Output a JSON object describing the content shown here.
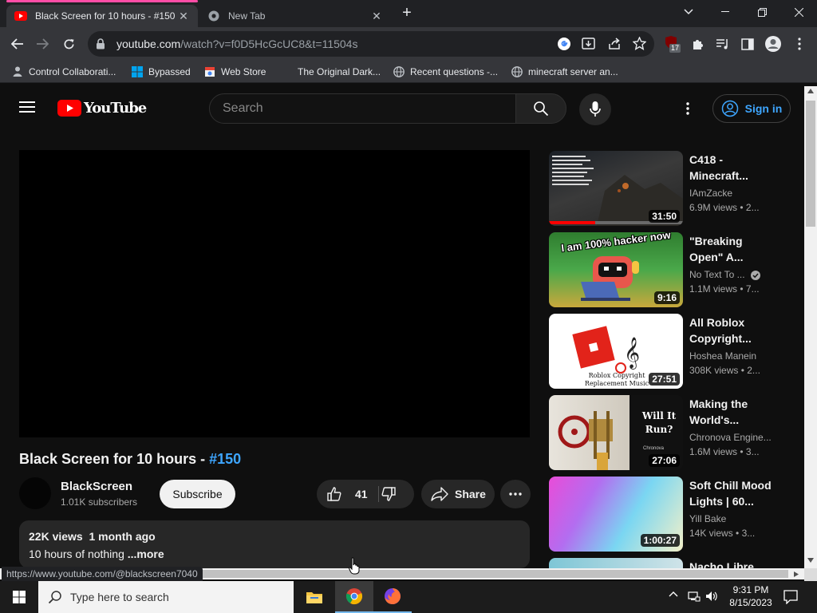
{
  "browser": {
    "tabs": [
      {
        "title": "Black Screen for 10 hours - #150",
        "active": true
      },
      {
        "title": "New Tab",
        "active": false
      }
    ],
    "url_host": "youtube.com",
    "url_path": "/watch?v=f0D5HcGcUC8&t=11504s",
    "extension_badge": "17",
    "bookmarks": [
      {
        "label": "Control Collaborati...",
        "icon": "globe-icon"
      },
      {
        "label": "Bypassed",
        "icon": "windows-icon"
      },
      {
        "label": "Web Store",
        "icon": "store-icon"
      },
      {
        "label": "The Original Dark...",
        "icon": "none"
      },
      {
        "label": "Recent questions -...",
        "icon": "globe-icon"
      },
      {
        "label": "minecraft server an...",
        "icon": "globe-icon"
      }
    ],
    "status_url": "https://www.youtube.com/@blackscreen7040"
  },
  "youtube": {
    "logo_text": "YouTube",
    "search_placeholder": "Search",
    "sign_in": "Sign in",
    "video": {
      "title": "Black Screen for 10 hours - ",
      "hashtag": "#150",
      "channel": "BlackScreen",
      "subscribers": "1.01K subscribers",
      "subscribe_label": "Subscribe",
      "likes": "41",
      "share_label": "Share",
      "views_date": "22K views  1 month ago",
      "description": "10 hours of nothing ",
      "more_label": "...more"
    },
    "recommendations": [
      {
        "title": "C418 - Minecraft...",
        "channel": "IAmZacke",
        "views": "6.9M views",
        "age": "2...",
        "duration": "31:50",
        "verified": false
      },
      {
        "title": "\"Breaking Open\" A...",
        "channel": "No Text To ...",
        "views": "1.1M views",
        "age": "7...",
        "duration": "9:16",
        "verified": true
      },
      {
        "title": "All Roblox Copyright...",
        "channel": "Hoshea Manein",
        "views": "308K views",
        "age": "2...",
        "duration": "27:51",
        "verified": false
      },
      {
        "title": "Making the World's...",
        "channel": "Chronova Engine...",
        "views": "1.6M views",
        "age": "3...",
        "duration": "27:06",
        "verified": false
      },
      {
        "title": "Soft Chill Mood Lights | 60...",
        "channel": "Yill Bake",
        "views": "14K views",
        "age": "3...",
        "duration": "1:00:27",
        "verified": false
      },
      {
        "title": "Nacho Libre...",
        "channel": "",
        "views": "",
        "age": "",
        "duration": "",
        "verified": false
      }
    ],
    "thumb_text": {
      "hacker": "I am 100% hacker now",
      "roblox_caption": "Roblox Copyright Replacement Music",
      "will_it_run": "Will It Run?",
      "chronova": "Chronova"
    }
  },
  "taskbar": {
    "search_placeholder": "Type here to search",
    "time": "9:31 PM",
    "date": "8/15/2023"
  },
  "colors": {
    "accent_blue": "#3ea6ff",
    "youtube_red": "#ff0000",
    "tab_indicator": "#ff4da6"
  }
}
